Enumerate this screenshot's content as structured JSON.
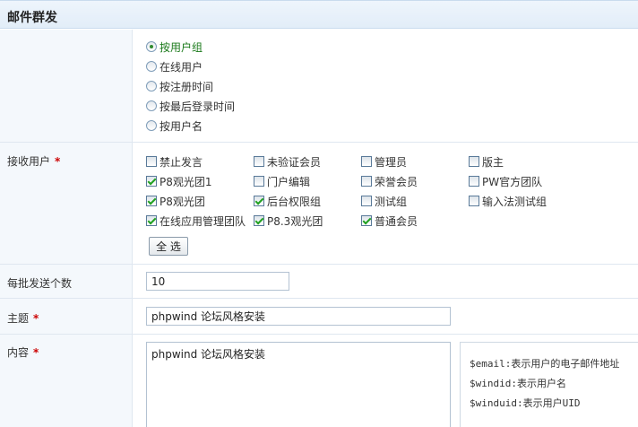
{
  "header": {
    "title": "邮件群发"
  },
  "send_mode": {
    "options": [
      {
        "label": "按用户组",
        "checked": true
      },
      {
        "label": "在线用户",
        "checked": false
      },
      {
        "label": "按注册时间",
        "checked": false
      },
      {
        "label": "按最后登录时间",
        "checked": false
      },
      {
        "label": "按用户名",
        "checked": false
      }
    ]
  },
  "recipients": {
    "label": "接收用户",
    "required_mark": "*",
    "groups": [
      {
        "label": "禁止发言",
        "checked": false
      },
      {
        "label": "未验证会员",
        "checked": false
      },
      {
        "label": "管理员",
        "checked": false
      },
      {
        "label": "版主",
        "checked": false
      },
      {
        "label": "P8观光团1",
        "checked": true
      },
      {
        "label": "门户编辑",
        "checked": false
      },
      {
        "label": "荣誉会员",
        "checked": false
      },
      {
        "label": "PW官方团队",
        "checked": false
      },
      {
        "label": "P8观光团",
        "checked": true
      },
      {
        "label": "后台权限组",
        "checked": true
      },
      {
        "label": "测试组",
        "checked": false
      },
      {
        "label": "输入法测试组",
        "checked": false
      },
      {
        "label": "在线应用管理团队",
        "checked": true
      },
      {
        "label": "P8.3观光团",
        "checked": true
      },
      {
        "label": "普通会员",
        "checked": true
      }
    ],
    "select_all_label": "全 选"
  },
  "batch": {
    "label": "每批发送个数",
    "value": "10"
  },
  "subject": {
    "label": "主题",
    "required_mark": "*",
    "value": "phpwind 论坛风格安装"
  },
  "content": {
    "label": "内容",
    "required_mark": "*",
    "value": "phpwind 论坛风格安装",
    "hints": [
      "$email:表示用户的电子邮件地址",
      "$windid:表示用户名",
      "$winduid:表示用户UID"
    ]
  },
  "colors": {
    "header_bg": "#e2edf8",
    "label_bg": "#f4f8fc",
    "required": "#cc0000",
    "active_radio_text": "#1b7a1b",
    "check": "#21a121"
  }
}
